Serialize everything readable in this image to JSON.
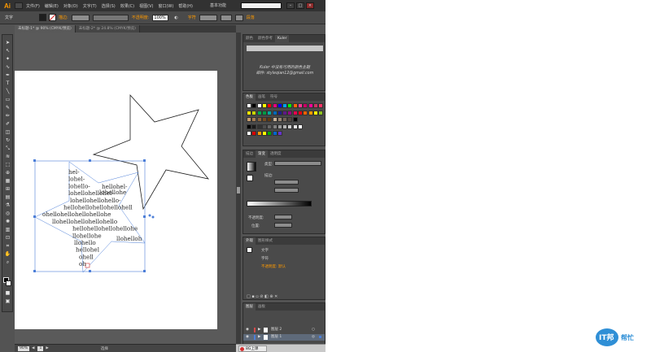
{
  "app": {
    "logo": "Ai",
    "menus": [
      "文件(F)",
      "编辑(E)",
      "对象(O)",
      "文字(T)",
      "选择(S)",
      "效果(C)",
      "视图(V)",
      "窗口(W)",
      "帮助(H)"
    ],
    "workspace": "基本功能",
    "window_controls": [
      "–",
      "□",
      "×"
    ]
  },
  "control_bar": {
    "tool_label": "文字",
    "stroke_label": "描边:",
    "opacity_label": "不透明度:",
    "opacity_value": "100%",
    "char_label": "字符",
    "para_label": "段落"
  },
  "tabs": [
    {
      "label": "未标题-1* @ 90% (CMYK/预览)",
      "active": true
    },
    {
      "label": "未标题-2* @ 24.8% (CMYK/预览)",
      "active": false
    }
  ],
  "artwork": {
    "text_lines": [
      "hel-",
      "lohel-",
      "lohello-",
      "lohellohellohel-",
      "lohellohellohello-",
      "hellohellohellohellohell",
      "ohellohellohellohellohe",
      "llohellohellohellohello",
      "hellohellohellohellohe",
      "llohellohe",
      "llohello",
      "hellohel",
      "ohell",
      "oh"
    ],
    "side_text_1": "hellohel-",
    "side_text_2": "lohellohe",
    "side_text_3": "llohelloh"
  },
  "status_bar": {
    "zoom": "90%",
    "page": "1",
    "tool": "选择"
  },
  "panels": {
    "color_tabs": [
      "颜色",
      "颜色参考",
      "Kuler"
    ],
    "kuler_text_1": "Kuler 中没有可用的颜色主题",
    "kuler_text_2": "邮件: styleqian12@gmail.com",
    "swatch_tabs": [
      "色板",
      "画笔",
      "符号"
    ],
    "appearance_tabs": [
      "描边",
      "渐变",
      "透明度"
    ],
    "gradient_type_label": "类型:",
    "stroke_label": "描边:",
    "opacity_label": "不透明度:",
    "position_label": "位置:",
    "appearance_title_tabs": [
      "外观",
      "图形样式"
    ],
    "appearance_rows": [
      "文字",
      "字符",
      "不透明度: 默认"
    ],
    "layers_tabs": [
      "图层",
      "画板"
    ],
    "layers": [
      {
        "name": "图层 2",
        "selected": false
      },
      {
        "name": "图层 1",
        "selected": true
      }
    ]
  },
  "taskbar": {
    "item": "8G上课"
  },
  "watermark": {
    "text": "IT邦帮忙"
  },
  "colors": {
    "accent_orange": "#ff9a00",
    "star_stroke": "#1c1c1c",
    "selection_blue": "#4d7fd8"
  }
}
